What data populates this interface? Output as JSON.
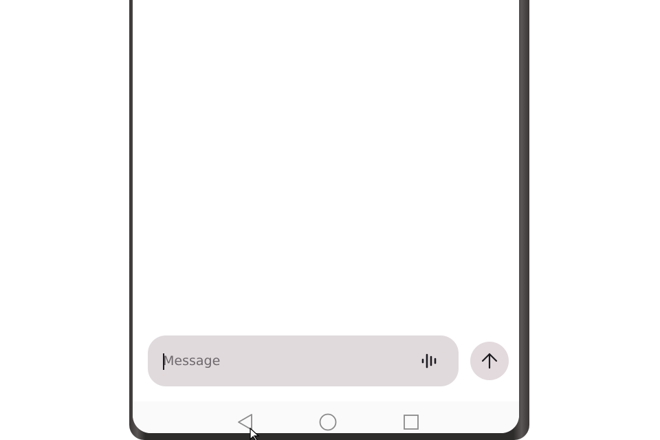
{
  "composer": {
    "placeholder": "Message",
    "value": ""
  },
  "icons": {
    "voice": "voice-waveform-icon",
    "send": "arrow-up-icon",
    "nav_back": "triangle-back-icon",
    "nav_home": "circle-home-icon",
    "nav_recents": "square-recents-icon"
  },
  "colors": {
    "composer_bg": "#e0dadd",
    "send_bg": "#e3dadd",
    "icon": "#1c1b1f",
    "placeholder": "#6e686c",
    "nav_icon": "#8a8a8a",
    "bezel": "#2e2b2b"
  }
}
